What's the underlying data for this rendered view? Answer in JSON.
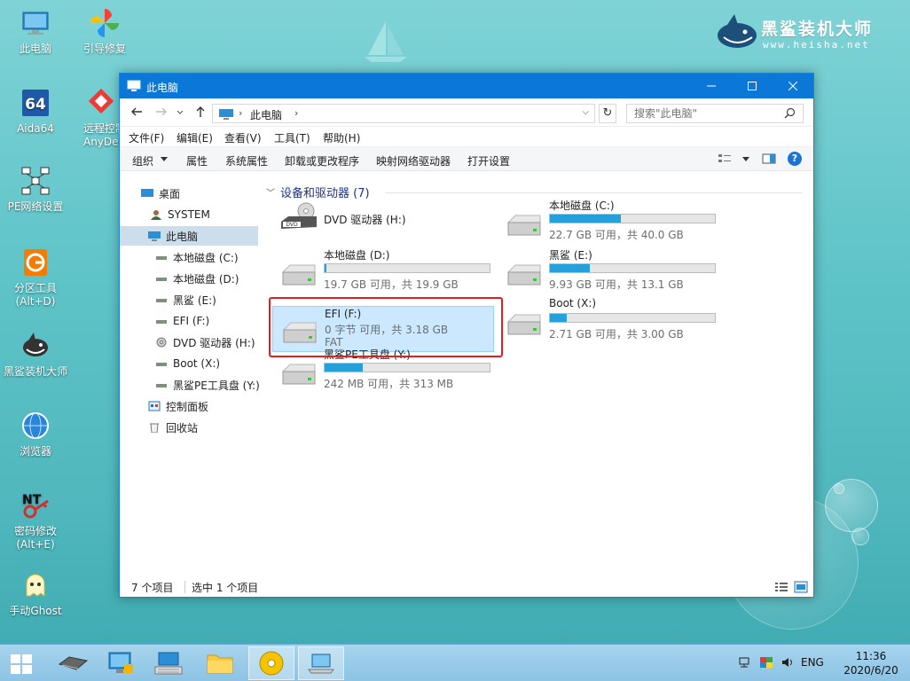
{
  "desktop": {
    "brand": {
      "name": "黑鲨装机大师",
      "url": "www.heisha.net"
    },
    "icons": [
      {
        "id": "this-pc",
        "label": "此电脑"
      },
      {
        "id": "boot-repair",
        "label": "引导修复"
      },
      {
        "id": "aida64",
        "label": "Aida64",
        "badge": "64"
      },
      {
        "id": "anydesk",
        "label": "远程控制",
        "label2": "AnyDesk"
      },
      {
        "id": "pe-network",
        "label": "PE网络设置"
      },
      {
        "id": "partition",
        "label": "分区工具",
        "label2": "(Alt+D)"
      },
      {
        "id": "heisha",
        "label": "黑鲨装机大师"
      },
      {
        "id": "browser",
        "label": "浏览器"
      },
      {
        "id": "password",
        "label": "密码修改",
        "label2": "(Alt+E)"
      },
      {
        "id": "ghost",
        "label": "手动Ghost"
      }
    ]
  },
  "window": {
    "title": "此电脑",
    "address": {
      "crumb": "此电脑"
    },
    "search": {
      "placeholder": "搜索\"此电脑\""
    },
    "menu": [
      "文件(F)",
      "编辑(E)",
      "查看(V)",
      "工具(T)",
      "帮助(H)"
    ],
    "commands": [
      "组织",
      "属性",
      "系统属性",
      "卸载或更改程序",
      "映射网络驱动器",
      "打开设置"
    ],
    "help_glyph": "?",
    "nav": [
      {
        "label": "桌面",
        "level": 0,
        "icon": "desktop-icon"
      },
      {
        "label": "SYSTEM",
        "level": 1,
        "icon": "user-icon"
      },
      {
        "label": "此电脑",
        "level": 1,
        "icon": "computer-icon",
        "selected": true
      },
      {
        "label": "本地磁盘 (C:)",
        "level": 2,
        "icon": "drive-icon"
      },
      {
        "label": "本地磁盘 (D:)",
        "level": 2,
        "icon": "drive-icon"
      },
      {
        "label": "黑鲨 (E:)",
        "level": 2,
        "icon": "drive-icon"
      },
      {
        "label": "EFI (F:)",
        "level": 2,
        "icon": "drive-icon"
      },
      {
        "label": "DVD 驱动器 (H:)",
        "level": 2,
        "icon": "dvd-icon"
      },
      {
        "label": "Boot (X:)",
        "level": 2,
        "icon": "drive-icon"
      },
      {
        "label": "黑鲨PE工具盘 (Y:)",
        "level": 2,
        "icon": "drive-icon"
      },
      {
        "label": "控制面板",
        "level": 1,
        "icon": "control-panel-icon"
      },
      {
        "label": "回收站",
        "level": 1,
        "icon": "recycle-bin-icon"
      }
    ],
    "group_title": "设备和驱动器 (7)",
    "drives": [
      {
        "name": "DVD 驱动器 (H:)",
        "kind": "dvd",
        "info": ""
      },
      {
        "name": "本地磁盘 (C:)",
        "kind": "hdd",
        "info": "22.7 GB 可用，共 40.0 GB",
        "used_fraction": 0.43
      },
      {
        "name": "本地磁盘 (D:)",
        "kind": "hdd",
        "info": "19.7 GB 可用，共 19.9 GB",
        "used_fraction": 0.01
      },
      {
        "name": "黑鲨 (E:)",
        "kind": "hdd",
        "info": "9.93 GB 可用，共 13.1 GB",
        "used_fraction": 0.24
      },
      {
        "name": "EFI (F:)",
        "kind": "hdd",
        "info": "0 字节 可用，共 3.18 GB",
        "fs": "FAT",
        "selected": true
      },
      {
        "name": "Boot (X:)",
        "kind": "hdd",
        "info": "2.71 GB 可用，共 3.00 GB",
        "used_fraction": 0.1
      },
      {
        "name": "黑鲨PE工具盘 (Y:)",
        "kind": "hdd",
        "info": "242 MB 可用，共 313 MB",
        "used_fraction": 0.23
      }
    ],
    "status": {
      "count": "7 个项目",
      "selection": "选中 1 个项目"
    }
  },
  "taskbar": {
    "lang": "ENG",
    "time": "11:36",
    "date": "2020/6/20"
  },
  "colors": {
    "accent": "#0b78d7",
    "bar_fill": "#26a0da",
    "highlight_frame": "#e02020"
  }
}
